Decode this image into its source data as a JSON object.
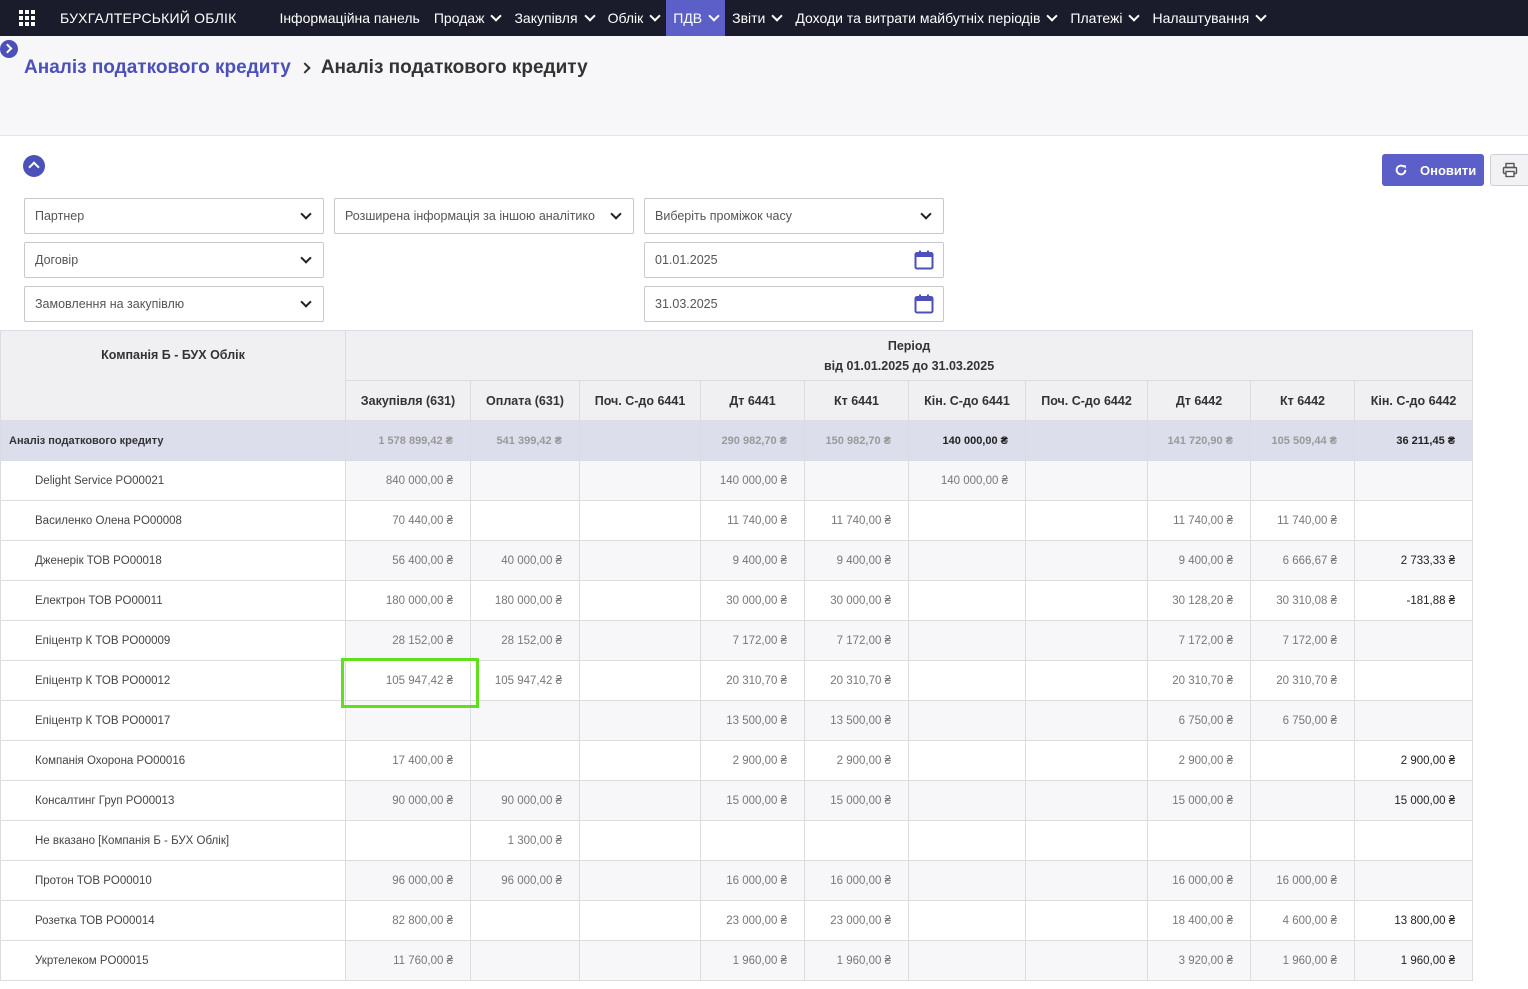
{
  "navbar": {
    "brand": "БУХГАЛТЕРСЬКИЙ ОБЛІК",
    "items": [
      {
        "label": "Інформаційна панель"
      },
      {
        "label": "Продаж"
      },
      {
        "label": "Закупівля"
      },
      {
        "label": "Облік"
      },
      {
        "label": "ПДВ"
      },
      {
        "label": "Звіти"
      },
      {
        "label": "Доходи та витрати майбутніх періодів"
      },
      {
        "label": "Платежі"
      },
      {
        "label": "Налаштування"
      }
    ]
  },
  "breadcrumb": {
    "parent": "Аналіз податкового кредиту",
    "current": "Аналіз податкового кредиту"
  },
  "toolbar": {
    "refresh_label": "Оновити"
  },
  "filters": {
    "partner": "Партнер",
    "contract": "Договір",
    "purchase_order": "Замовлення на закупівлю",
    "extended_info": "Розширена інформація за іншою аналітико",
    "period_select": "Виберіть проміжок часу",
    "date_from": "01.01.2025",
    "date_to": "31.03.2025"
  },
  "table": {
    "company_header": "Компанія Б - БУХ Облік",
    "period_title": "Період",
    "period_range": "від 01.01.2025 до 31.03.2025",
    "columns": [
      "Закупівля (631)",
      "Оплата (631)",
      "Поч. С-до 6441",
      "Дт 6441",
      "Кт 6441",
      "Кін. С-до 6441",
      "Поч. С-до 6442",
      "Дт 6442",
      "Кт 6442",
      "Кін. С-до 6442"
    ],
    "total": {
      "label": "Аналіз податкового кредиту",
      "values": [
        "1 578 899,42 ₴",
        "541 399,42 ₴",
        "",
        "290 982,70 ₴",
        "150 982,70 ₴",
        "140 000,00 ₴",
        "",
        "141 720,90 ₴",
        "105 509,44 ₴",
        "36 211,45 ₴"
      ]
    },
    "rows": [
      {
        "label": "Delight Service PO00021",
        "values": [
          "840 000,00 ₴",
          "",
          "",
          "140 000,00 ₴",
          "",
          "140 000,00 ₴",
          "",
          "",
          "",
          ""
        ]
      },
      {
        "label": "Василенко Олена PO00008",
        "values": [
          "70 440,00 ₴",
          "",
          "",
          "11 740,00 ₴",
          "11 740,00 ₴",
          "",
          "",
          "11 740,00 ₴",
          "11 740,00 ₴",
          ""
        ]
      },
      {
        "label": "Дженерік ТОВ PO00018",
        "values": [
          "56 400,00 ₴",
          "40 000,00 ₴",
          "",
          "9 400,00 ₴",
          "9 400,00 ₴",
          "",
          "",
          "9 400,00 ₴",
          "6 666,67 ₴",
          "2 733,33 ₴"
        ]
      },
      {
        "label": "Електрон ТОВ PO00011",
        "values": [
          "180 000,00 ₴",
          "180 000,00 ₴",
          "",
          "30 000,00 ₴",
          "30 000,00 ₴",
          "",
          "",
          "30 128,20 ₴",
          "30 310,08 ₴",
          "-181,88 ₴"
        ]
      },
      {
        "label": "Епіцентр К ТОВ PO00009",
        "values": [
          "28 152,00 ₴",
          "28 152,00 ₴",
          "",
          "7 172,00 ₴",
          "7 172,00 ₴",
          "",
          "",
          "7 172,00 ₴",
          "7 172,00 ₴",
          ""
        ]
      },
      {
        "label": "Епіцентр К ТОВ PO00012",
        "values": [
          "105 947,42 ₴",
          "105 947,42 ₴",
          "",
          "20 310,70 ₴",
          "20 310,70 ₴",
          "",
          "",
          "20 310,70 ₴",
          "20 310,70 ₴",
          ""
        ]
      },
      {
        "label": "Епіцентр К ТОВ PO00017",
        "values": [
          "",
          "",
          "",
          "13 500,00 ₴",
          "13 500,00 ₴",
          "",
          "",
          "6 750,00 ₴",
          "6 750,00 ₴",
          ""
        ]
      },
      {
        "label": "Компанія Охорона PO00016",
        "values": [
          "17 400,00 ₴",
          "",
          "",
          "2 900,00 ₴",
          "2 900,00 ₴",
          "",
          "",
          "2 900,00 ₴",
          "",
          "2 900,00 ₴"
        ]
      },
      {
        "label": "Консалтинг Груп PO00013",
        "values": [
          "90 000,00 ₴",
          "90 000,00 ₴",
          "",
          "15 000,00 ₴",
          "15 000,00 ₴",
          "",
          "",
          "15 000,00 ₴",
          "",
          "15 000,00 ₴"
        ]
      },
      {
        "label": "Не вказано [Компанія Б - БУХ Облік]",
        "values": [
          "",
          "1 300,00 ₴",
          "",
          "",
          "",
          "",
          "",
          "",
          "",
          ""
        ]
      },
      {
        "label": "Протон ТОВ PO00010",
        "values": [
          "96 000,00 ₴",
          "96 000,00 ₴",
          "",
          "16 000,00 ₴",
          "16 000,00 ₴",
          "",
          "",
          "16 000,00 ₴",
          "16 000,00 ₴",
          ""
        ]
      },
      {
        "label": "Розетка ТОВ PO00014",
        "values": [
          "82 800,00 ₴",
          "",
          "",
          "23 000,00 ₴",
          "23 000,00 ₴",
          "",
          "",
          "18 400,00 ₴",
          "4 600,00 ₴",
          "13 800,00 ₴"
        ]
      },
      {
        "label": "Укртелеком PO00015",
        "values": [
          "11 760,00 ₴",
          "",
          "",
          "1 960,00 ₴",
          "1 960,00 ₴",
          "",
          "",
          "3 920,00 ₴",
          "1 960,00 ₴",
          "1 960,00 ₴"
        ]
      }
    ]
  },
  "colors": {
    "navbar": "#1b1c2b",
    "accent": "#5b5fc7",
    "link": "#4b51b8",
    "highlight": "#5fe01a",
    "total_row": "#dddeec"
  },
  "icons": [
    "apps-grid-icon",
    "chevron-down-icon",
    "sidebar-expand-icon",
    "collapse-up-icon",
    "refresh-icon",
    "print-icon",
    "calendar-icon"
  ]
}
